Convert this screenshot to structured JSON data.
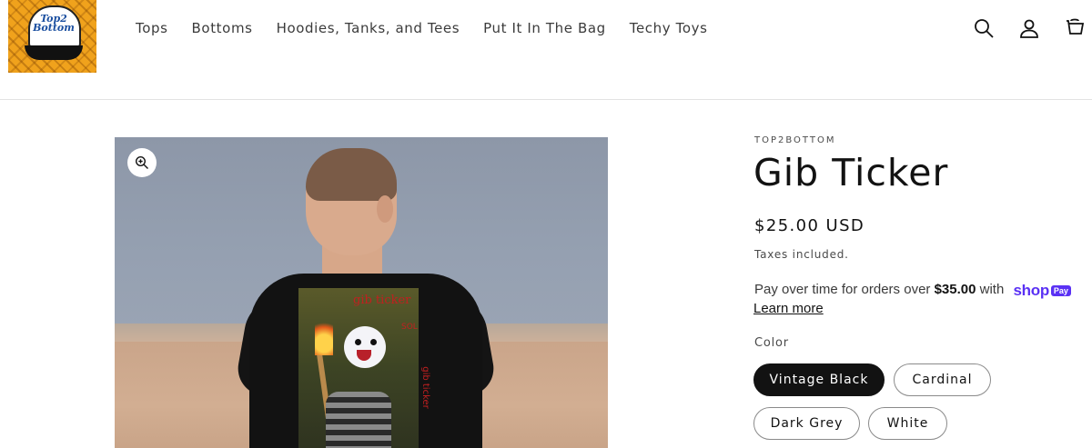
{
  "header": {
    "logo_text": "Top2 Bottom",
    "nav": [
      "Tops",
      "Bottoms",
      "Hoodies, Tanks, and Tees",
      "Put It In The Bag",
      "Techy Toys"
    ],
    "icons": [
      "search-icon",
      "account-icon",
      "cart-icon"
    ]
  },
  "product": {
    "vendor": "TOP2BOTTOM",
    "title": "Gib Ticker",
    "price": "$25.00 USD",
    "tax_note": "Taxes included.",
    "installments": {
      "prefix": "Pay over time for orders over",
      "amount": "$35.00",
      "suffix": "with",
      "brand": "shop",
      "brand_badge": "Pay",
      "learn_more": "Learn more"
    },
    "color_label": "Color",
    "colors": [
      "Vintage Black",
      "Cardinal",
      "Dark Grey",
      "White"
    ],
    "selected_color": "Vintage Black",
    "image_print_text": [
      "gib ticker",
      "SOL",
      "gib ticker"
    ],
    "accent_color": "#5a31f4"
  }
}
